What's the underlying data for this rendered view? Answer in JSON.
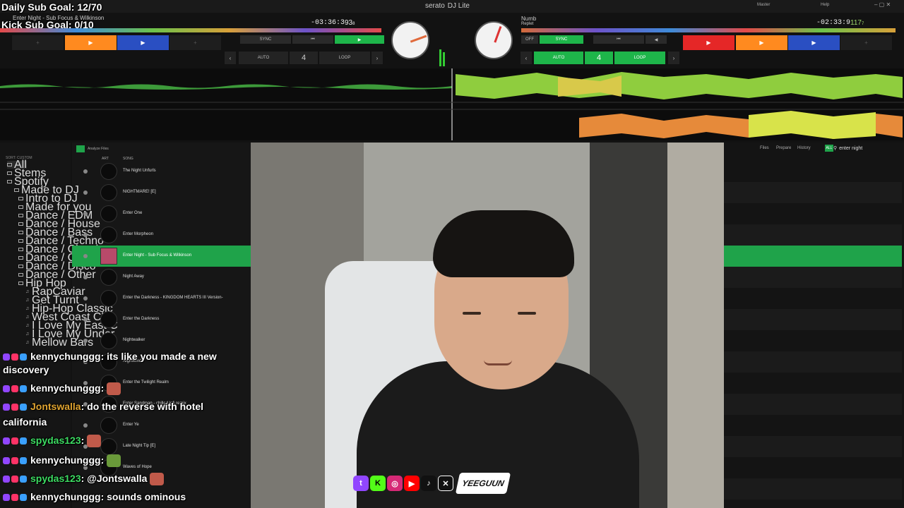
{
  "overlay": {
    "sub_goal": "Daily Sub Goal: 12/70",
    "kick_goal": "Kick Sub Goal: 0/10"
  },
  "app": {
    "logo": "serato",
    "product": "DJ Lite",
    "master_label": "Master",
    "help_label": "Help"
  },
  "deck_left": {
    "title": "Enter Night - Sub Focus & Wilkinson",
    "time": "-03:36:3",
    "bpm": "93",
    "bpm_decimals": "8",
    "sync": "SYNC",
    "auto": "AUTO",
    "loop": "LOOP",
    "loop_size": "4",
    "cue_colors": [
      "#ff8a1f",
      "#2a4fc2"
    ]
  },
  "deck_right": {
    "title": "Numb",
    "artist": "Replet",
    "time": "-02:33:9",
    "bpm": "117",
    "bpm_decimals": "7",
    "sync": "SYNC",
    "off": "OFF",
    "auto": "AUTO",
    "loop": "LOOP",
    "loop_size": "4",
    "cue_colors": [
      "#e52727",
      "#ff8a1f",
      "#2a4fc2"
    ]
  },
  "library": {
    "sort_label": "SORT: CUSTOM",
    "analyze": "Analyze Files",
    "col_art": "ART",
    "col_song": "SONG",
    "tabs": [
      "Files",
      "Prepare",
      "History"
    ],
    "search_value": "enter night",
    "all_toggle": "ALL",
    "sidebar": [
      {
        "label": "All",
        "type": "root"
      },
      {
        "label": "Stems",
        "type": "root"
      },
      {
        "label": "Spotify",
        "type": "root"
      },
      {
        "label": "Made to DJ",
        "type": "folder"
      },
      {
        "label": "Intro to DJ",
        "type": "folder"
      },
      {
        "label": "Made for you",
        "type": "folder"
      },
      {
        "label": "Dance / EDM",
        "type": "folder"
      },
      {
        "label": "Dance / House",
        "type": "folder"
      },
      {
        "label": "Dance / Bass",
        "type": "folder"
      },
      {
        "label": "Dance / Techno",
        "type": "folder"
      },
      {
        "label": "Dance / Classics",
        "type": "folder"
      },
      {
        "label": "Dance / Club",
        "type": "folder"
      },
      {
        "label": "Dance / Disco",
        "type": "folder"
      },
      {
        "label": "Dance / Other",
        "type": "folder"
      },
      {
        "label": "Hip Hop",
        "type": "folder"
      },
      {
        "label": "RapCaviar",
        "type": "playlist"
      },
      {
        "label": "Get Turnt",
        "type": "playlist"
      },
      {
        "label": "Hip-Hop Classic",
        "type": "playlist"
      },
      {
        "label": "West Coast Clas",
        "type": "playlist"
      },
      {
        "label": "I Love My East C",
        "type": "playlist"
      },
      {
        "label": "I Love My Under",
        "type": "playlist"
      },
      {
        "label": "Mellow Bars",
        "type": "playlist"
      }
    ],
    "tracks": [
      "The Night Unfurls",
      "NIGHTMARE! [E]",
      "Enter One",
      "Enter Morpheon",
      "Enter Night - Sub Focus & Wilkinson",
      "Night Away",
      "Enter the Darkness - KINGDOM HEARTS III Version-",
      "Enter the Darkness",
      "Nightwalker",
      "Nightwind",
      "Enter the Twilight Realm",
      "Enter Sandman - chilled lofi remix",
      "Enter Ye",
      "Late Night Tip [E]",
      "Waves of Hope"
    ],
    "selected_track": 4
  },
  "chat": [
    {
      "user": "kennychunggg",
      "message": ": its like you made a new",
      "color": "#ffffff"
    },
    {
      "user": "",
      "message": "discovery",
      "color": "#ffffff"
    },
    {
      "user": "kennychunggg",
      "message": ":",
      "color": "#ffffff"
    },
    {
      "user": "Jontswalla",
      "message": ": do the reverse with hotel",
      "color": "#e0a431"
    },
    {
      "user": "",
      "message": "california",
      "color": "#ffffff"
    },
    {
      "user": "spydas123",
      "message": ":",
      "color": "#3ddc62"
    },
    {
      "user": "kennychunggg",
      "message": ":",
      "color": "#ffffff"
    },
    {
      "user": "spydas123",
      "message": ": @Jontswalla",
      "color": "#3ddc62"
    },
    {
      "user": "kennychunggg",
      "message": ": sounds ominous",
      "color": "#ffffff"
    }
  ],
  "socials": {
    "icons": [
      "twitch-icon",
      "kick-icon",
      "instagram-icon",
      "youtube-icon",
      "tiktok-icon",
      "x-icon"
    ],
    "brand": "YEEGUUN"
  },
  "colors": {
    "accent": "#1fa34a",
    "wave_green": "#5cc24a",
    "wave_yellow": "#d8e34a",
    "wave_orange": "#e68a3a"
  }
}
